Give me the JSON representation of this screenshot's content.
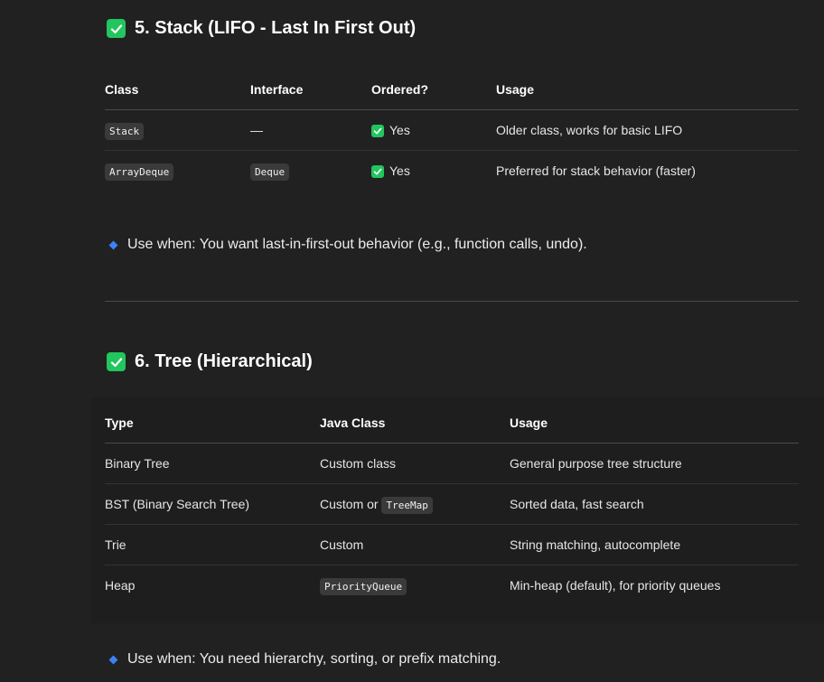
{
  "stack_section": {
    "title": "5. Stack (LIFO - Last In First Out)",
    "headers": [
      "Class",
      "Interface",
      "Ordered?",
      "Usage"
    ],
    "rows": [
      {
        "class": "Stack",
        "interface": "—",
        "ordered": "Yes",
        "usage": "Older class, works for basic LIFO"
      },
      {
        "class": "ArrayDeque",
        "interface": "Deque",
        "ordered": "Yes",
        "usage": "Preferred for stack behavior (faster)"
      }
    ],
    "note": "Use when: You want last-in-first-out behavior (e.g., function calls, undo)."
  },
  "tree_section": {
    "title": "6. Tree (Hierarchical)",
    "headers": [
      "Type",
      "Java Class",
      "Usage"
    ],
    "rows": [
      {
        "type": "Binary Tree",
        "java_class": "Custom class",
        "usage": "General purpose tree structure"
      },
      {
        "type": "BST (Binary Search Tree)",
        "java_class_prefix": "Custom or",
        "java_class_code": "TreeMap",
        "usage": "Sorted data, fast search"
      },
      {
        "type": "Trie",
        "java_class": "Custom",
        "usage": "String matching, autocomplete"
      },
      {
        "type": "Heap",
        "java_class_code": "PriorityQueue",
        "usage": "Min-heap (default), for priority queues"
      }
    ],
    "note": "Use when: You need hierarchy, sorting, or prefix matching."
  },
  "colors": {
    "background": "#212121",
    "check_green": "#22c55e",
    "bullet_blue": "#3b82f6"
  }
}
